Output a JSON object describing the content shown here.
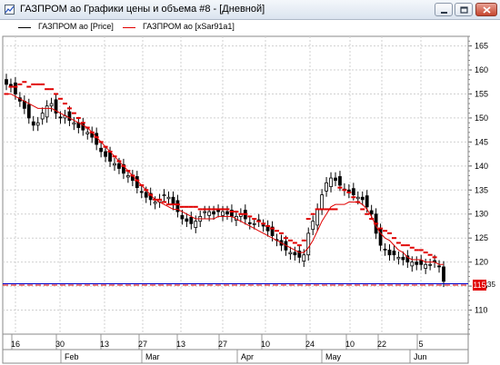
{
  "window": {
    "title": "ГАЗПРОМ ао Графики цены и объема #8 - [Дневной]",
    "icon": "chart-app-icon",
    "buttons": [
      "minimize-icon",
      "restore-icon",
      "close-icon"
    ]
  },
  "legend": [
    {
      "label": "ГАЗПРОМ ао [Price]",
      "color": "#000000"
    },
    {
      "label": "ГАЗПРОМ ао [xSar91a1]",
      "color": "#e00000"
    }
  ],
  "price_badge": {
    "value": "115",
    "decimals": "35",
    "color": "#e00000"
  },
  "chart_data": {
    "type": "candlestick",
    "y_axis": {
      "min": 105,
      "max": 167,
      "ticks": [
        110,
        115,
        120,
        125,
        130,
        135,
        140,
        145,
        150,
        155,
        160,
        165
      ],
      "side": "right"
    },
    "x_axis": {
      "day_labels": [
        "16",
        "30",
        "13",
        "27",
        "13",
        "27",
        "10",
        "24",
        "10",
        "22",
        "5"
      ],
      "month_labels": [
        "Feb",
        "Mar",
        "Apr",
        "May",
        "Jun"
      ]
    },
    "grid": true,
    "horizontal_lines": [
      {
        "value": 115.35,
        "colors": [
          "#0000cc",
          "#e00000"
        ]
      }
    ],
    "series": [
      {
        "name": "ГАЗПРОМ ао [Price]",
        "kind": "candles",
        "close": [
          157,
          156.5,
          155,
          153.5,
          152,
          150,
          148.5,
          149,
          151,
          152.5,
          153,
          151,
          150,
          150.5,
          149.5,
          149,
          148,
          147.5,
          147,
          146,
          144.5,
          143,
          142,
          141,
          140.5,
          139.5,
          138.5,
          138,
          137,
          135.5,
          134.5,
          133.5,
          133,
          132.5,
          133,
          134,
          133.5,
          132,
          130.5,
          129,
          128.5,
          128,
          128.5,
          129.5,
          130.5,
          130.5,
          130,
          130.5,
          130.5,
          130,
          129.5,
          129.5,
          130,
          129,
          128,
          128,
          128.5,
          127.5,
          126.5,
          125.5,
          124.5,
          123.5,
          122.5,
          122,
          121.5,
          121,
          121.5,
          126,
          128.5,
          131,
          134,
          136.5,
          137.5,
          137,
          136,
          135,
          134.5,
          134,
          133.5,
          133,
          131.5,
          130,
          126,
          123.5,
          122.5,
          121.5,
          121.5,
          121,
          120.5,
          120,
          120,
          119.5,
          119.5,
          119.5,
          119.5,
          120,
          119,
          116
        ]
      },
      {
        "name": "ГАЗПРОМ ао [xSar91a1]",
        "kind": "sar-dots",
        "color": "#e00000",
        "values": [
          155,
          156.5,
          156.5,
          157,
          157.5,
          156.5,
          157,
          157,
          157,
          156,
          156,
          155,
          154,
          153,
          152,
          151,
          150,
          149,
          148,
          147,
          146,
          145,
          144,
          143,
          142,
          141,
          140,
          139,
          138,
          137,
          136,
          135,
          134,
          133,
          133,
          132.5,
          132,
          132,
          132,
          131.5,
          131.5,
          131.5,
          131.5,
          131,
          131,
          131,
          131,
          131,
          131,
          131,
          130.5,
          130.5,
          130,
          130,
          129.5,
          129,
          128.5,
          128,
          127.5,
          127,
          126.5,
          126,
          125,
          124.5,
          124,
          123.5,
          124.5,
          129,
          130,
          131,
          131,
          131,
          131,
          131,
          135.5,
          135,
          134.5,
          133.5,
          132.5,
          131,
          130,
          129,
          128,
          127,
          126.5,
          126,
          125,
          124,
          123.5,
          123.5,
          123,
          122.5,
          122.5,
          122,
          121.5,
          121
        ]
      },
      {
        "name": "ГАЗПРОМ ао [xSar91a1] line",
        "kind": "line",
        "color": "#e00000",
        "values": [
          155,
          155,
          154.5,
          154,
          153.5,
          153,
          152.5,
          152,
          152,
          152,
          152,
          151.5,
          151,
          150.5,
          150,
          149.5,
          149,
          148.5,
          148,
          147,
          146,
          145,
          144,
          143,
          142,
          141,
          140,
          139,
          138,
          137,
          136,
          135,
          134,
          133,
          132.5,
          132,
          131.5,
          131,
          131,
          130.5,
          130,
          129.5,
          129,
          129,
          129,
          129,
          129,
          129.5,
          129.5,
          129.5,
          129.5,
          129,
          128.5,
          128,
          127.5,
          127,
          126.5,
          126,
          125.5,
          125,
          124.5,
          124,
          123.5,
          123,
          122.5,
          122,
          122,
          123,
          124.5,
          126.5,
          128.5,
          130,
          131.5,
          132,
          132,
          132,
          132.5,
          132.5,
          132.5,
          132,
          131,
          129.5,
          127.5,
          126,
          125,
          124.5,
          123.5,
          122.5,
          122,
          121,
          120.5,
          120.5,
          120.5,
          120,
          120,
          120,
          119.5,
          119.5
        ]
      }
    ]
  }
}
